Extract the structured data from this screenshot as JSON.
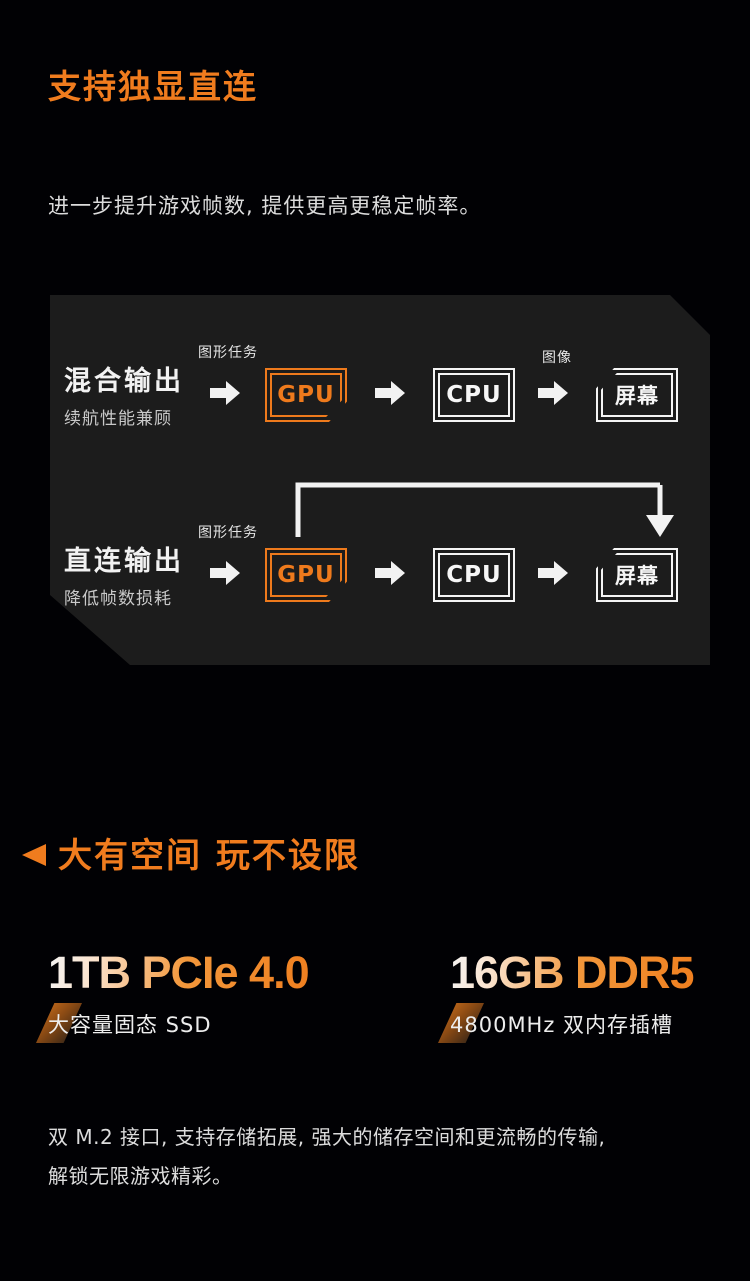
{
  "sections": {
    "gpu_direct": {
      "title": "支持独显直连",
      "subtitle": "进一步提升游戏帧数, 提供更高更稳定帧率。",
      "diagram": {
        "rows": [
          {
            "mode": "混合输出",
            "mode_sub": "续航性能兼顾",
            "task_label": "图形任务",
            "image_label": "图像",
            "nodes": [
              "GPU",
              "CPU",
              "屏幕"
            ],
            "bypass": false
          },
          {
            "mode": "直连输出",
            "mode_sub": "降低帧数损耗",
            "task_label": "图形任务",
            "image_label": "",
            "nodes": [
              "GPU",
              "CPU",
              "屏幕"
            ],
            "bypass": true
          }
        ]
      }
    },
    "storage_memory": {
      "title": "大有空间 玩不设限",
      "specs": [
        {
          "value": "1TB PCIe 4.0",
          "sub": "大容量固态 SSD"
        },
        {
          "value": "16GB DDR5",
          "sub": "4800MHz 双内存插槽"
        }
      ],
      "paragraph_line1": "双 M.2 接口, 支持存储拓展, 强大的储存空间和更流畅的传输,",
      "paragraph_line2": "解锁无限游戏精彩。"
    }
  },
  "colors": {
    "accent_orange": "#f07c1e",
    "panel_bg": "#1c1c1c",
    "page_bg": "#010104",
    "text_white": "#f2f2f2"
  }
}
